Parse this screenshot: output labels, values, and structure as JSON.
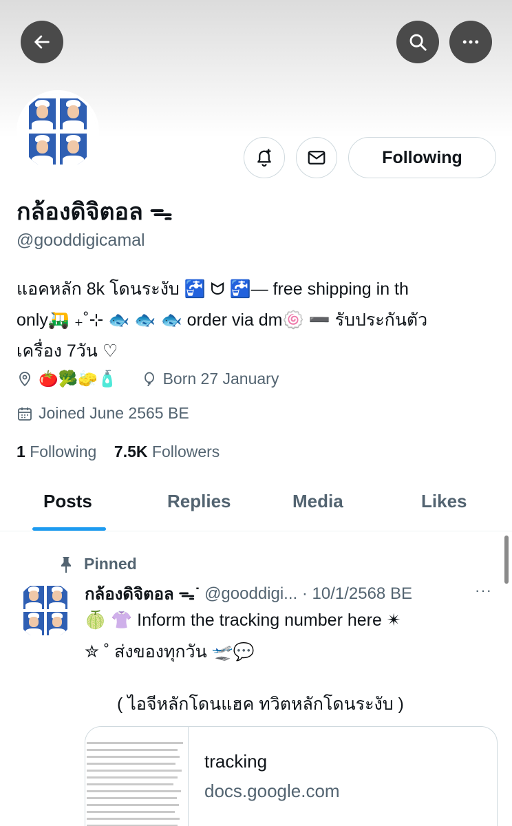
{
  "header": {
    "back_icon": "arrow-left-icon",
    "search_icon": "search-icon",
    "more_icon": "more-horizontal-icon"
  },
  "profile": {
    "display_name": "กล้องดิจิตอล ᯓ",
    "handle": "@gooddigicamal",
    "bio_lines": [
      "แอคหลัก 8k โดนระงับ  🚰 ᗢ  🚰— free shipping in th",
      "only🛺 ₊˚⊹ 🐟 🐟 🐟 order via dm🍥 ➖ รับประกันตัว",
      "เครื่อง 7วัน ♡"
    ],
    "location": "🍅🥦🧽🧴",
    "birthday": "Born 27 January",
    "joined": "Joined June 2565 BE",
    "following_count": "1",
    "following_label": "Following",
    "followers_count": "7.5K",
    "followers_label": "Followers",
    "follow_button": "Following"
  },
  "tabs": [
    "Posts",
    "Replies",
    "Media",
    "Likes"
  ],
  "active_tab": "Posts",
  "pinned_tweet": {
    "pinned_label": "Pinned",
    "author_name": "กล้องดิจิตอล ᯓ˙",
    "author_handle": "@gooddigi... · 10/1/2568 BE",
    "more": "···",
    "text_line1": "🍈 👚 Inform the tracking number here ✴",
    "text_line2": "✮ ˚ ส่งของทุกวัน   🛫💬",
    "text_line3": "( ไอจีหลักโดนแฮค ทวิตหลักโดนระงับ )",
    "card_title": "tracking",
    "card_domain": "docs.google.com"
  },
  "colors": {
    "accent": "#1d9bf0",
    "secondary_text": "#536471",
    "primary_text": "#0f1419",
    "border": "#cfd9de"
  }
}
